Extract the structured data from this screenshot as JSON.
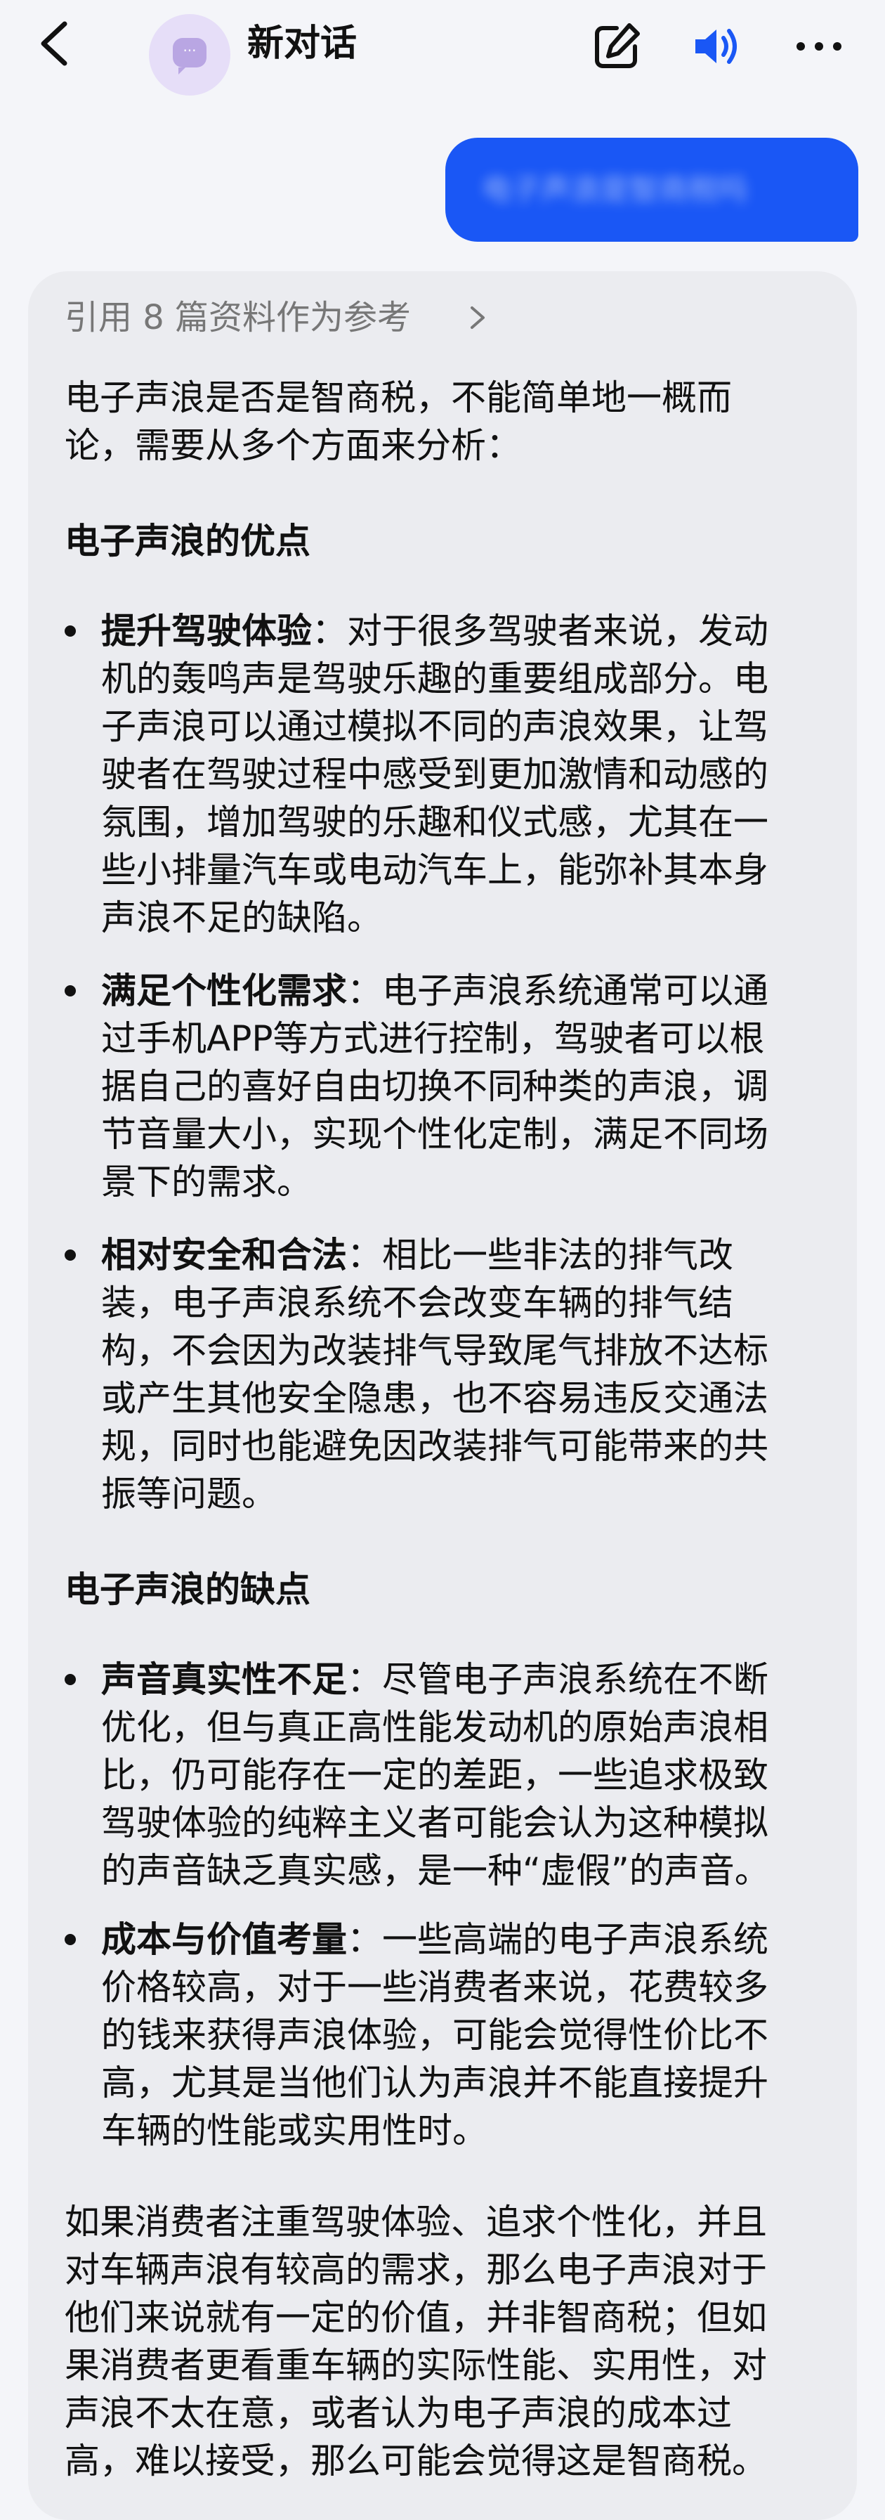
{
  "header": {
    "title": "新对话",
    "icons": [
      "back-icon",
      "chat-bubble-icon",
      "edit-icon",
      "speaker-icon",
      "more-icon"
    ],
    "accent_color": "#1a57f5"
  },
  "user_message": {
    "bubble_color": "#1a57f5",
    "text": "电子声浪是智商税吗"
  },
  "answer": {
    "references": "引用 8 篇资料作为参考",
    "intro": [
      "电子声浪是否是智商税，不能简单地一概而",
      "论，需要从多个方面来分析："
    ],
    "pros_heading": "电子声浪的优点",
    "pros": [
      {
        "bold": "提升驾驶体验",
        "first": "：对于很多驾驶者来说，发动",
        "lines": [
          "机的轰鸣声是驾驶乐趣的重要组成部分。电",
          "子声浪可以通过模拟不同的声浪效果，让驾",
          "驶者在驾驶过程中感受到更加激情和动感的",
          "氛围，增加驾驶的乐趣和仪式感，尤其在一",
          "些小排量汽车或电动汽车上，能弥补其本身",
          "声浪不足的缺陷。"
        ]
      },
      {
        "bold": "满足个性化需求",
        "first": "：电子声浪系统通常可以通",
        "lines": [
          "过手机APP等方式进行控制，驾驶者可以根",
          "据自己的喜好自由切换不同种类的声浪，调",
          "节音量大小，实现个性化定制，满足不同场",
          "景下的需求。"
        ]
      },
      {
        "bold": "相对安全和合法",
        "first": "：相比一些非法的排气改",
        "lines": [
          "装，电子声浪系统不会改变车辆的排气结",
          "构，不会因为改装排气导致尾气排放不达标",
          "或产生其他安全隐患，也不容易违反交通法",
          "规，同时也能避免因改装排气可能带来的共",
          "振等问题。"
        ]
      }
    ],
    "cons_heading": "电子声浪的缺点",
    "cons": [
      {
        "bold": "声音真实性不足",
        "first": "：尽管电子声浪系统在不断",
        "lines": [
          "优化，但与真正高性能发动机的原始声浪相",
          "比，仍可能存在一定的差距，一些追求极致",
          "驾驶体验的纯粹主义者可能会认为这种模拟",
          "的声音缺乏真实感，是一种“虚假”的声音。"
        ]
      },
      {
        "bold": "成本与价值考量",
        "first": "：一些高端的电子声浪系统",
        "lines": [
          "价格较高，对于一些消费者来说，花费较多",
          "的钱来获得声浪体验，可能会觉得性价比不",
          "高，尤其是当他们认为声浪并不能直接提升",
          "车辆的性能或实用性时。"
        ]
      }
    ],
    "conclusion": [
      "如果消费者注重驾驶体验、追求个性化，并且",
      "对车辆声浪有较高的需求，那么电子声浪对于",
      "他们来说就有一定的价值，并非智商税；但如",
      "果消费者更看重车辆的实际性能、实用性，对",
      "声浪不太在意，或者认为电子声浪的成本过",
      "高，难以接受，那么可能会觉得这是智商税。"
    ]
  }
}
